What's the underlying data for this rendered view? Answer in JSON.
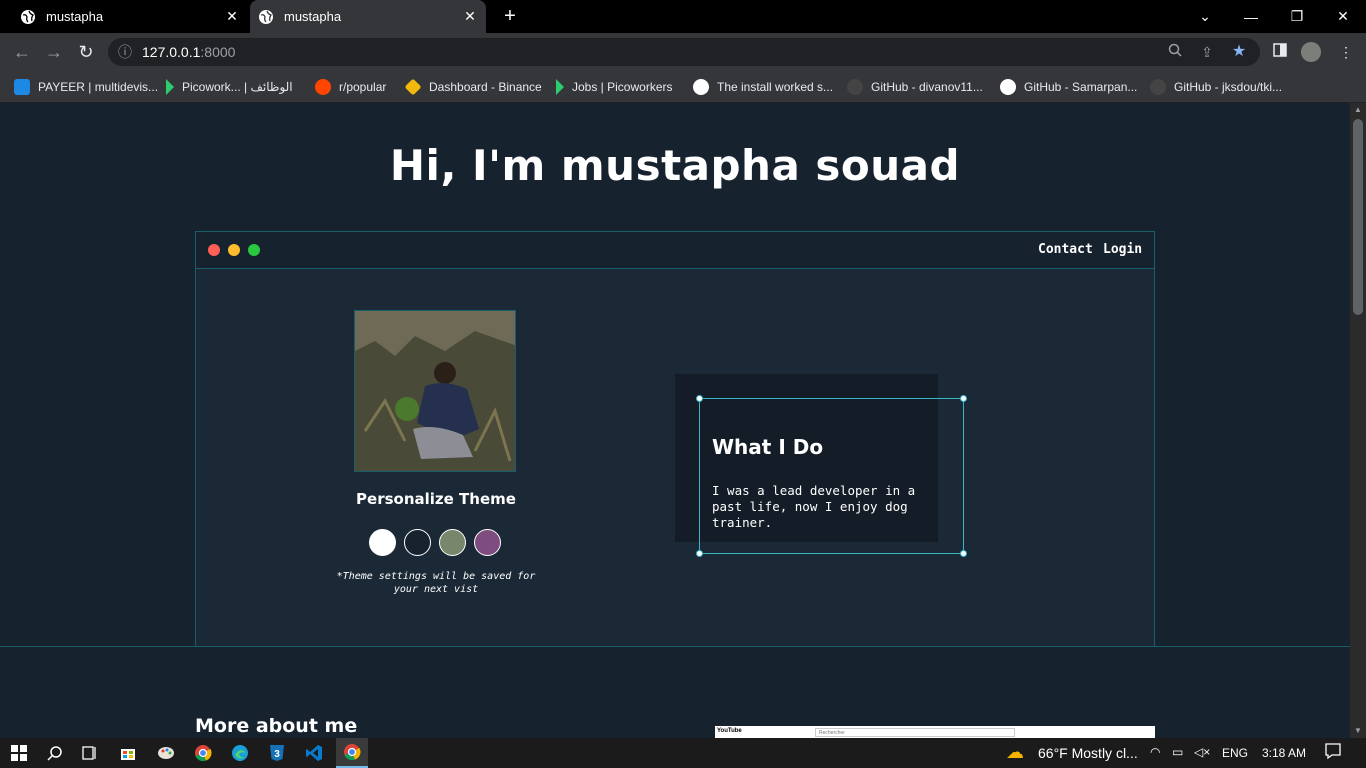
{
  "browser": {
    "tabs": [
      {
        "title": "mustapha",
        "active": false
      },
      {
        "title": "mustapha",
        "active": true
      }
    ],
    "new_tab_label": "+",
    "window_controls": {
      "collapse": "⌄",
      "minimize": "—",
      "restore": "❐",
      "close": "✕"
    },
    "url_host": "127.0.0.1",
    "url_port": ":8000",
    "bookmarks": [
      {
        "label": "PAYEER | multidevis...",
        "icon": "payeer-icon",
        "color": "#1e88e5"
      },
      {
        "label": "Picowork... | الوظائف",
        "icon": "picoworkers-icon",
        "color": "#2ecc71"
      },
      {
        "label": "r/popular",
        "icon": "reddit-icon",
        "color": "#ff4500"
      },
      {
        "label": "Dashboard - Binance",
        "icon": "binance-icon",
        "color": "#f0b90b"
      },
      {
        "label": "Jobs | Picoworkers",
        "icon": "picoworkers-icon",
        "color": "#2ecc71"
      },
      {
        "label": "The install worked s...",
        "icon": "globe-icon",
        "color": "#ffffff"
      },
      {
        "label": "GitHub - divanov11...",
        "icon": "github-icon",
        "color": "#444444"
      },
      {
        "label": "GitHub - Samarpan...",
        "icon": "globe-icon",
        "color": "#ffffff"
      },
      {
        "label": "GitHub - jksdou/tki...",
        "icon": "github-icon",
        "color": "#444444"
      }
    ]
  },
  "page": {
    "hero_title": "Hi, I'm mustapha souad",
    "nav": {
      "contact": "Contact",
      "login": "Login"
    },
    "window_dots": [
      "#ff5f57",
      "#febc2e",
      "#28c840"
    ],
    "theme_title": "Personalize Theme",
    "theme_swatches": [
      {
        "name": "light",
        "color": "#ffffff"
      },
      {
        "name": "dark",
        "color": "#17222f"
      },
      {
        "name": "green",
        "color": "#78866b"
      },
      {
        "name": "purple",
        "color": "#7e4c7e"
      }
    ],
    "theme_note": "*Theme settings will be saved for your next vist",
    "card_title": "What I Do",
    "card_text": "I was a lead developer in a past life, now I enjoy dog trainer.",
    "more_title": "More about me",
    "yt_logo": "YouTube",
    "yt_search_placeholder": "Rechercher"
  },
  "taskbar": {
    "weather": "66°F  Mostly cl...",
    "language": "ENG",
    "time": "3:18 AM"
  },
  "colors": {
    "accent": "#38b6c6",
    "page_bg": "#17222f",
    "window_border": "#1b5e6b"
  }
}
